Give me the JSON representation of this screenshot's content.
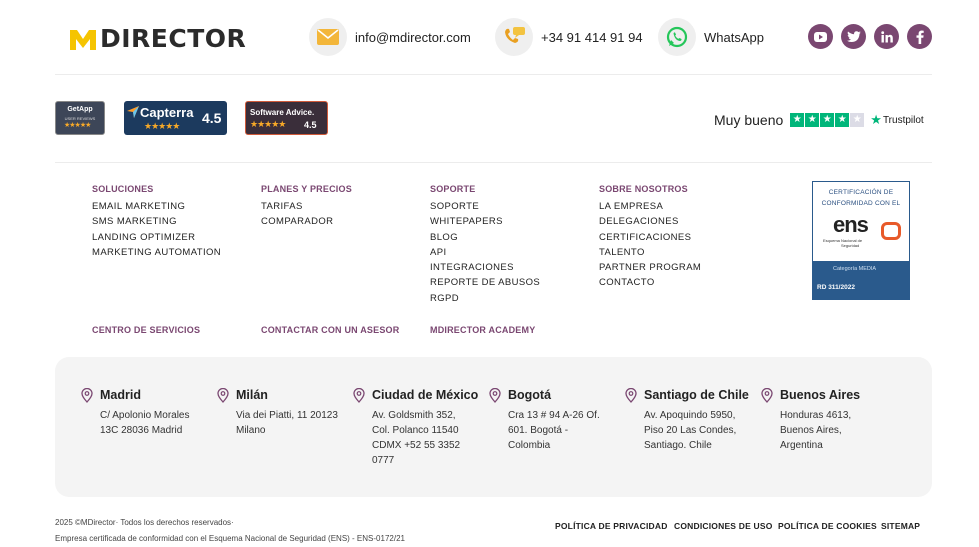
{
  "brand": {
    "logo_text": "DIRECTOR",
    "logo_mark": "M",
    "accent": "#f5c400",
    "purple": "#7a4771"
  },
  "header": {
    "email": "info@mdirector.com",
    "phone": "+34 91 414 91 94",
    "whatsapp": "WhatsApp",
    "social_icons": [
      "youtube-icon",
      "twitter-icon",
      "linkedin-icon",
      "facebook-icon"
    ]
  },
  "ratings": {
    "getapp": {
      "title": "GetApp",
      "subtitle": "USER REVIEWS",
      "stars": "★★★★★"
    },
    "capterra": {
      "title": "Capterra",
      "score": "4.5",
      "stars": "★★★★★"
    },
    "software_advice": {
      "title": "Software Advice.",
      "score": "4.5",
      "stars": "★★★★★"
    },
    "trustpilot": {
      "label": "Muy bueno",
      "brand": "Trustpilot",
      "filled_stars": 4,
      "total_stars": 5
    }
  },
  "nav": {
    "columns": [
      {
        "title": "SOLUCIONES",
        "links": [
          "EMAIL MARKETING",
          "SMS MARKETING",
          "LANDING OPTIMIZER",
          "MARKETING AUTOMATION"
        ]
      },
      {
        "title": "PLANES Y PRECIOS",
        "links": [
          "TARIFAS",
          "COMPARADOR"
        ]
      },
      {
        "title": "SOPORTE",
        "links": [
          "SOPORTE",
          "WHITEPAPERS",
          "BLOG",
          "API",
          "INTEGRACIONES",
          "REPORTE DE ABUSOS",
          "RGPD"
        ]
      },
      {
        "title": "SOBRE NOSOTROS",
        "links": [
          "LA EMPRESA",
          "DELEGACIONES",
          "CERTIFICACIONES",
          "TALENTO",
          "PARTNER PROGRAM",
          "CONTACTO"
        ]
      }
    ],
    "secondary": [
      "CENTRO DE SERVICIOS",
      "CONTACTAR CON UN ASESOR",
      "MDIRECTOR ACADEMY"
    ]
  },
  "ens_badge": {
    "heading_1": "CERTIFICACIÓN DE",
    "heading_2": "CONFORMIDAD CON EL",
    "logo_word": "ens",
    "caption_1": "Esquema Nacional de",
    "caption_2": "Seguridad",
    "category": "Categoría MEDIA",
    "rd": "RD 311/2022"
  },
  "offices": [
    {
      "city": "Madrid",
      "lines": [
        "C/ Apolonio Morales",
        "13C 28036 Madrid"
      ]
    },
    {
      "city": "Milán",
      "lines": [
        "Via dei Piatti, 11 20123",
        "Milano"
      ]
    },
    {
      "city": "Ciudad de México",
      "lines": [
        "Av. Goldsmith 352,",
        "Col. Polanco 11540",
        "CDMX +52 55 3352",
        "0777"
      ]
    },
    {
      "city": "Bogotá",
      "lines": [
        "Cra 13 # 94 A-26 Of.",
        "601. Bogotá -",
        "Colombia"
      ]
    },
    {
      "city": "Santiago de Chile",
      "lines": [
        "Av. Apoquindo 5950,",
        "Piso 20 Las Condes,",
        "Santiago. Chile"
      ]
    },
    {
      "city": "Buenos Aires",
      "lines": [
        "Honduras 4613,",
        "Buenos Aires,",
        "Argentina"
      ]
    }
  ],
  "footer": {
    "copyright": "2025 ©MDirector· Todos los derechos reservados·",
    "certification": "Empresa certificada de conformidad con el Esquema Nacional de Seguridad (ENS) - ENS-0172/21",
    "legal_links": [
      "POLÍTICA DE PRIVACIDAD",
      "CONDICIONES DE USO",
      "POLÍTICA DE COOKIES",
      "SITEMAP"
    ]
  }
}
